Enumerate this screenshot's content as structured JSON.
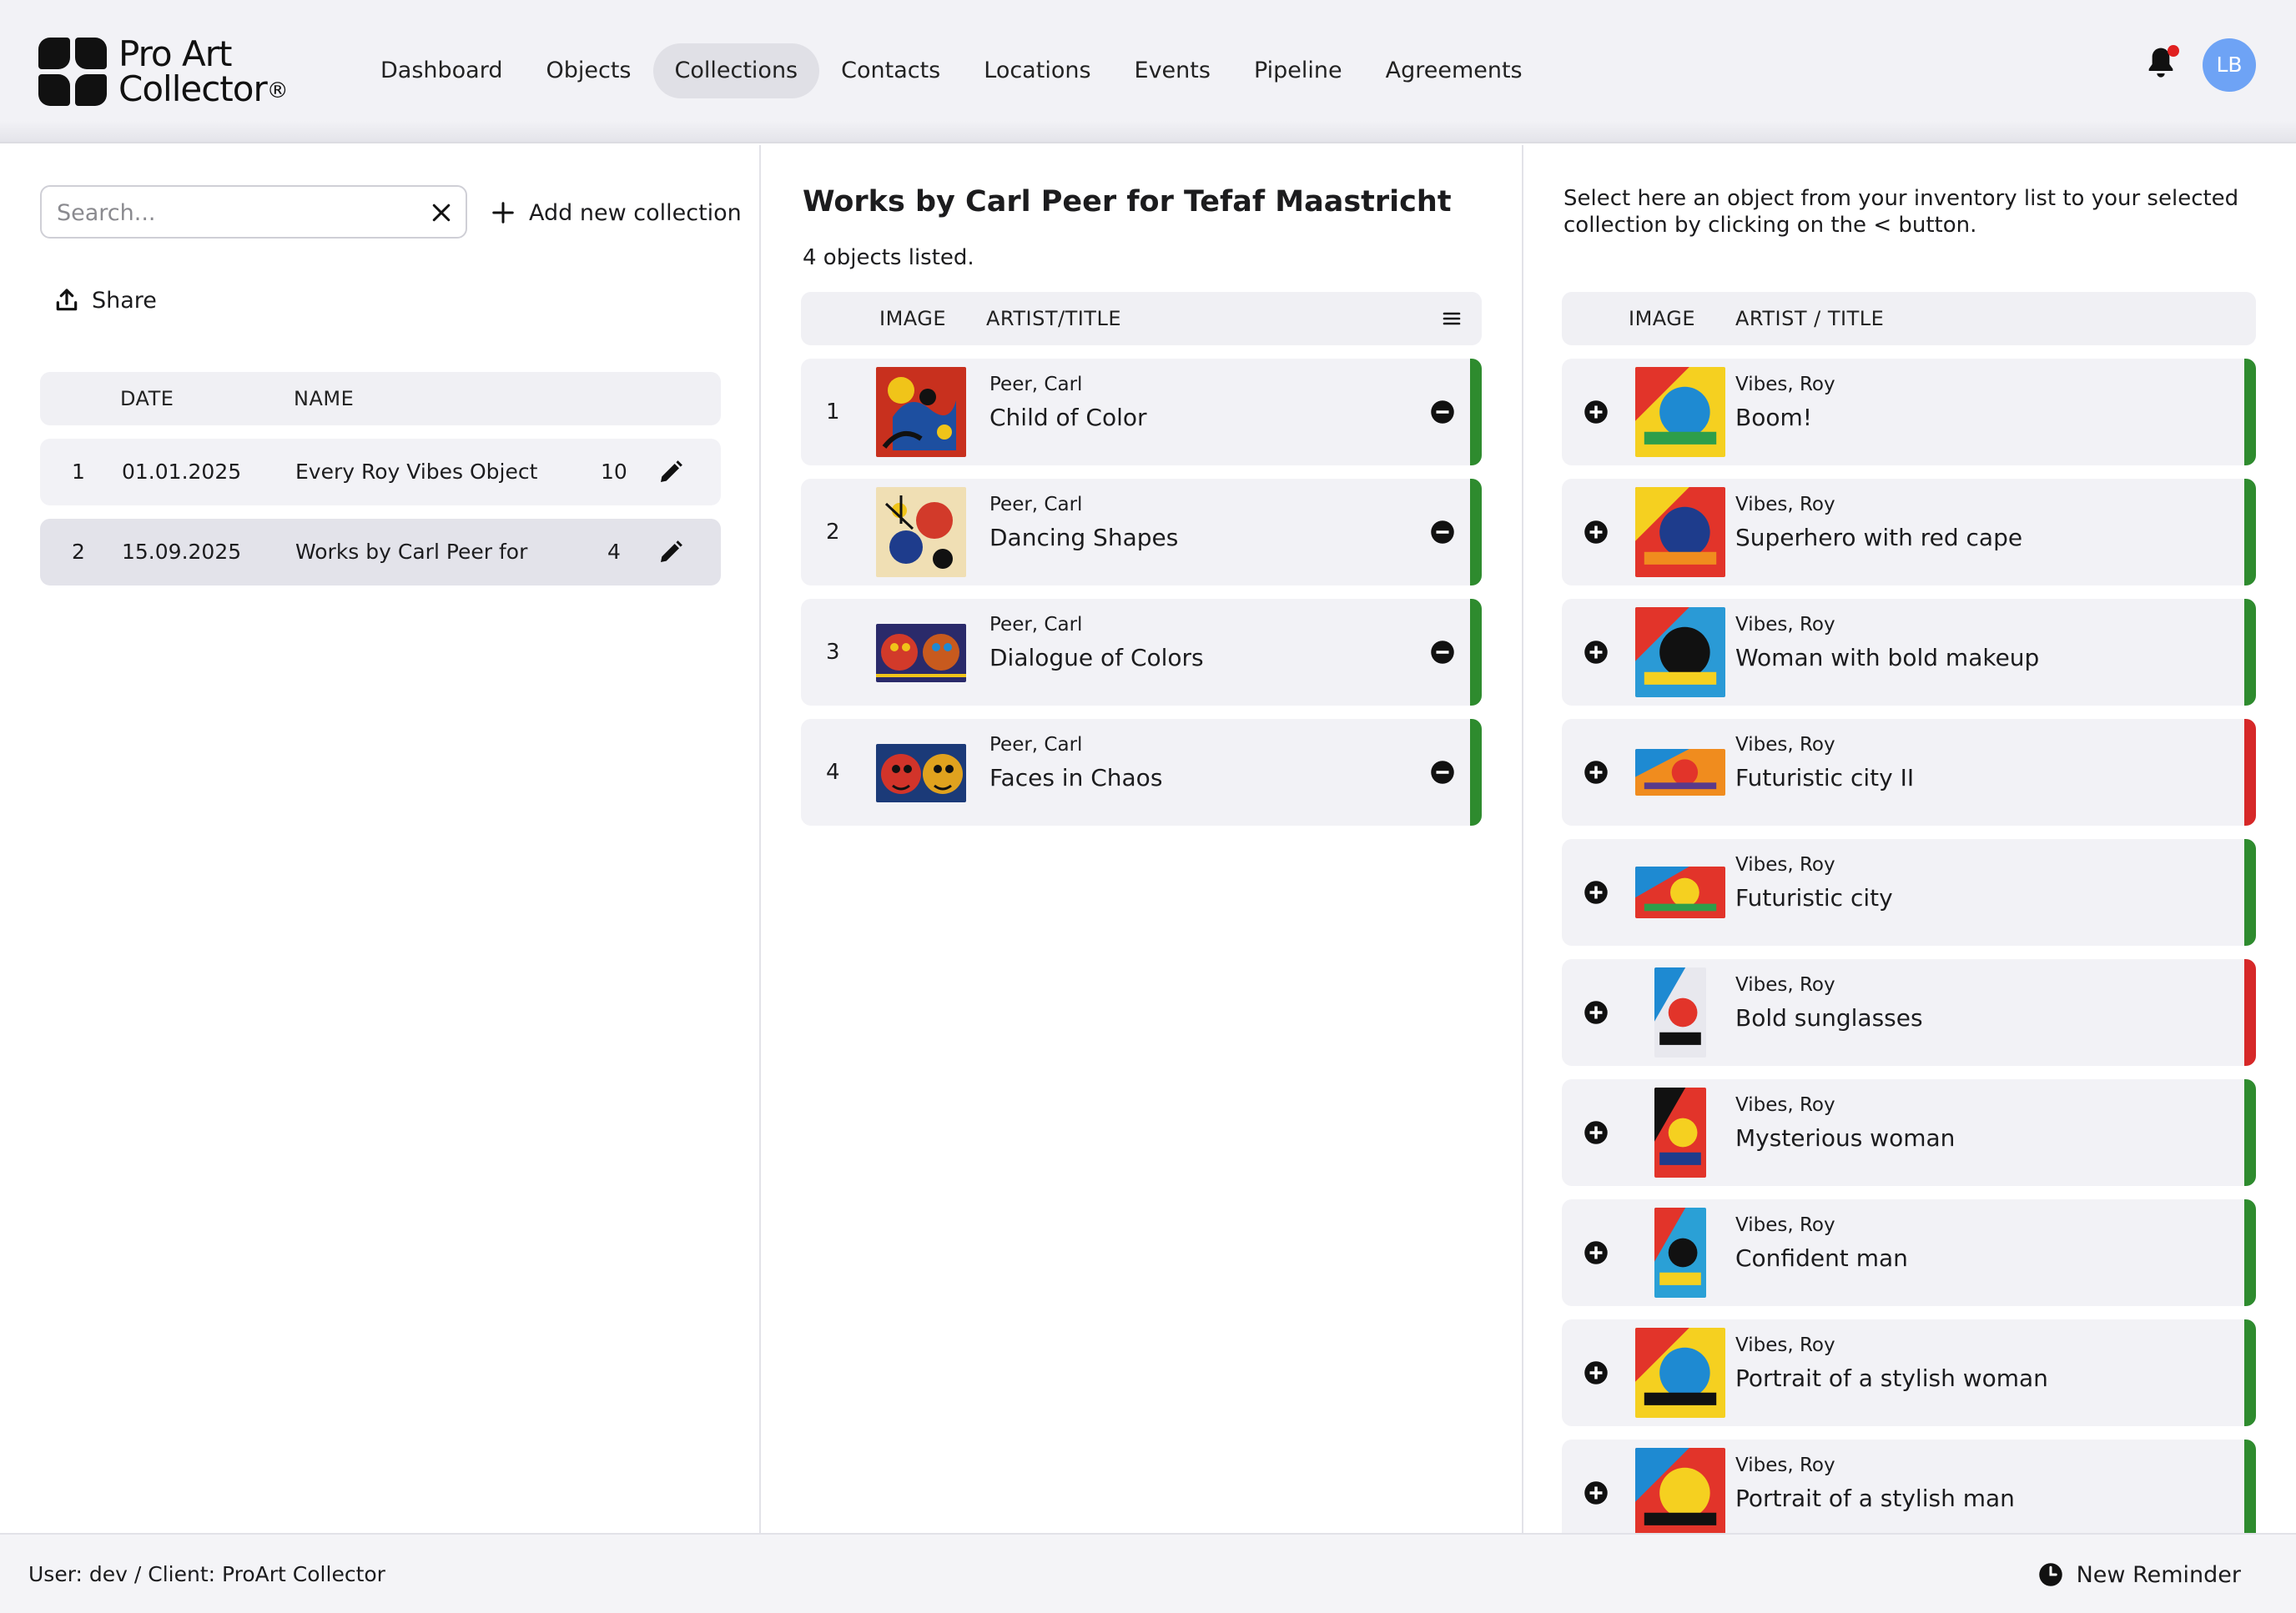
{
  "logo": {
    "line1": "Pro Art",
    "line2": "Collector",
    "reg": "®"
  },
  "nav": [
    {
      "label": "Dashboard"
    },
    {
      "label": "Objects"
    },
    {
      "label": "Collections",
      "active": true
    },
    {
      "label": "Contacts"
    },
    {
      "label": "Locations"
    },
    {
      "label": "Events"
    },
    {
      "label": "Pipeline"
    },
    {
      "label": "Agreements"
    }
  ],
  "user_avatar": "LB",
  "icons": {
    "bell": "bell-icon",
    "clear": "close-icon",
    "add": "plus-icon",
    "share": "share-icon",
    "edit": "pencil-icon",
    "remove": "minus-circle-icon",
    "add_object": "plus-circle-icon",
    "menu": "menu-icon",
    "clock": "clock-icon"
  },
  "colors": {
    "accent_avatar": "#6ea3f5",
    "status_green": "#2e8b2e",
    "status_red": "#d62828",
    "notification": "#e02020"
  },
  "left": {
    "search_placeholder": "Search...",
    "add_collection": "Add new collection",
    "share": "Share",
    "columns": {
      "date": "DATE",
      "name": "NAME"
    },
    "collections": [
      {
        "index": "1",
        "date": "01.01.2025",
        "name": "Every Roy Vibes Object",
        "count": "10"
      },
      {
        "index": "2",
        "date": "15.09.2025",
        "name": "Works by Carl Peer for",
        "count": "4",
        "selected": true
      }
    ]
  },
  "middle": {
    "title": "Works by Carl Peer for Tefaf Maastricht",
    "count_text": "4 objects listed.",
    "columns": {
      "image": "IMAGE",
      "artist_title": "ARTIST/TITLE"
    },
    "objects": [
      {
        "index": "1",
        "artist": "Peer, Carl",
        "title": "Child of Color",
        "status": "green"
      },
      {
        "index": "2",
        "artist": "Peer, Carl",
        "title": "Dancing Shapes",
        "status": "green"
      },
      {
        "index": "3",
        "artist": "Peer, Carl",
        "title": "Dialogue of Colors",
        "status": "green"
      },
      {
        "index": "4",
        "artist": "Peer, Carl",
        "title": "Faces in Chaos",
        "status": "green"
      }
    ]
  },
  "right": {
    "hint": "Select here an object from your inventory list to your selected collection by clicking on the < button.",
    "columns": {
      "image": "IMAGE",
      "artist_title": "ARTIST / TITLE"
    },
    "inventory": [
      {
        "artist": "Vibes, Roy",
        "title": "Boom!",
        "status": "green"
      },
      {
        "artist": "Vibes, Roy",
        "title": "Superhero with red cape",
        "status": "green"
      },
      {
        "artist": "Vibes, Roy",
        "title": "Woman with bold makeup",
        "status": "green"
      },
      {
        "artist": "Vibes, Roy",
        "title": "Futuristic city II",
        "status": "red"
      },
      {
        "artist": "Vibes, Roy",
        "title": "Futuristic city",
        "status": "green"
      },
      {
        "artist": "Vibes, Roy",
        "title": "Bold sunglasses",
        "status": "red"
      },
      {
        "artist": "Vibes, Roy",
        "title": "Mysterious woman",
        "status": "green"
      },
      {
        "artist": "Vibes, Roy",
        "title": "Confident man",
        "status": "green"
      },
      {
        "artist": "Vibes, Roy",
        "title": "Portrait of a stylish woman",
        "status": "green"
      },
      {
        "artist": "Vibes, Roy",
        "title": "Portrait of a stylish man",
        "status": "green"
      }
    ]
  },
  "footer": {
    "user_text": "User: dev / Client: ProArt Collector",
    "reminder": "New Reminder"
  }
}
